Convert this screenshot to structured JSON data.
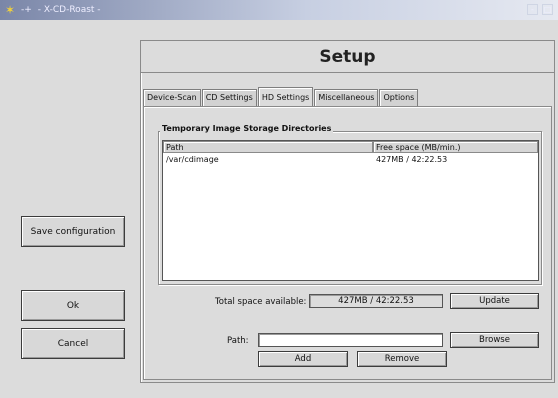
{
  "titlebar": {
    "menu": "-+",
    "title": "- X-CD-Roast -",
    "buttons": [
      "-",
      "□"
    ]
  },
  "left": {
    "save_config": "Save configuration",
    "ok": "Ok",
    "cancel": "Cancel"
  },
  "main": {
    "title": "Setup",
    "tabs": [
      "Device-Scan",
      "CD Settings",
      "HD Settings",
      "Miscellaneous",
      "Options"
    ],
    "active_tab": "HD Settings",
    "frame_label": "Temporary Image Storage Directories",
    "table": {
      "headers": [
        "Path",
        "Free space (MB/min.)"
      ],
      "rows": [
        [
          "/var/cdimage",
          "427MB / 42:22.53"
        ]
      ]
    },
    "total_label": "Total space available:",
    "total_value": "427MB / 42:22.53",
    "update": "Update",
    "path_label": "Path:",
    "path_value": "",
    "browse": "Browse",
    "add": "Add",
    "remove": "Remove"
  }
}
